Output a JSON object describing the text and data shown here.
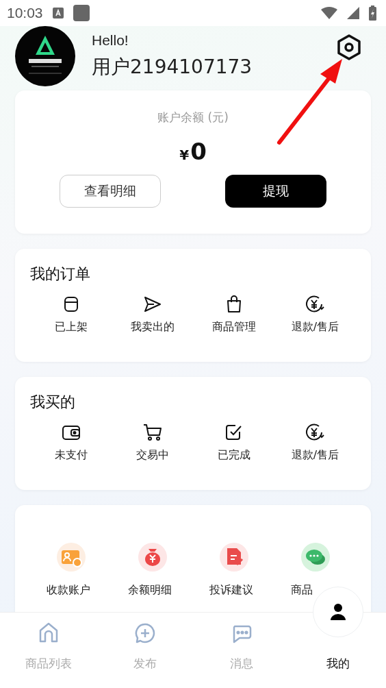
{
  "status_bar": {
    "time": "10:03"
  },
  "profile": {
    "greeting": "Hello!",
    "username": "用户2194107173"
  },
  "balance": {
    "label": "账户余额 (元)",
    "currency": "¥",
    "amount": "0",
    "buttons": [
      {
        "label": "查看明细",
        "kind": "outline"
      },
      {
        "label": "提现",
        "kind": "filled"
      }
    ]
  },
  "sections": [
    {
      "title": "我的订单",
      "items": [
        {
          "label": "已上架",
          "kind": "box"
        },
        {
          "label": "我卖出的",
          "kind": "send"
        },
        {
          "label": "商品管理",
          "kind": "bag"
        },
        {
          "label": "退款/售后",
          "kind": "refund"
        }
      ]
    },
    {
      "title": "我买的",
      "items": [
        {
          "label": "未支付",
          "kind": "wallet"
        },
        {
          "label": "交易中",
          "kind": "cart"
        },
        {
          "label": "已完成",
          "kind": "check"
        },
        {
          "label": "退款/售后",
          "kind": "refund"
        }
      ]
    }
  ],
  "services": [
    {
      "label": "收款账户",
      "color": "#f9a23a"
    },
    {
      "label": "余额明细",
      "color": "#ec4848"
    },
    {
      "label": "投诉建议",
      "color": "#e94c4c"
    },
    {
      "label": "商品",
      "color": "#3cb96a"
    }
  ],
  "tabs": [
    {
      "label": "商品列表",
      "selected": false
    },
    {
      "label": "发布",
      "selected": false
    },
    {
      "label": "消息",
      "selected": false
    },
    {
      "label": "我的",
      "selected": true
    }
  ]
}
